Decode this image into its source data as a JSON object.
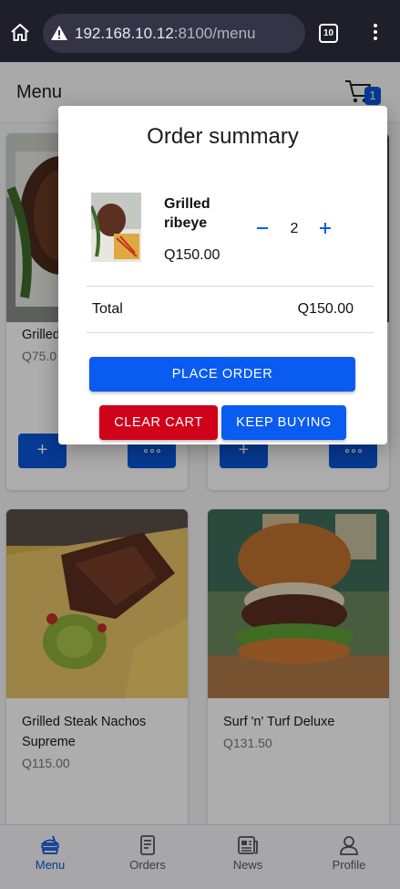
{
  "browser": {
    "url_host": "192.168.10.12",
    "url_path": ":8100/menu",
    "tab_count": "10",
    "icons": [
      "home-icon",
      "warning-icon",
      "tabs-icon",
      "kebab-menu-icon"
    ]
  },
  "header": {
    "title": "Menu",
    "cart_count": "1"
  },
  "menu": {
    "items": [
      {
        "name": "Grilled",
        "price": "Q75.0"
      },
      {
        "name": "",
        "price": ""
      },
      {
        "name": "Grilled Steak Nachos Supreme",
        "price": "Q115.00"
      },
      {
        "name": "Surf 'n' Turf Deluxe",
        "price": "Q131.50"
      }
    ],
    "add_label": "+"
  },
  "modal": {
    "title": "Order summary",
    "item": {
      "name": "Grilled ribeye",
      "price": "Q150.00",
      "quantity": "2"
    },
    "total_label": "Total",
    "total_value": "Q150.00",
    "place_order": "PLACE ORDER",
    "clear_cart": "CLEAR CART",
    "keep_buying": "KEEP BUYING"
  },
  "nav": {
    "items": [
      {
        "label": "Menu",
        "icon": "menu-food-icon",
        "active": true
      },
      {
        "label": "Orders",
        "icon": "orders-icon",
        "active": false
      },
      {
        "label": "News",
        "icon": "news-icon",
        "active": false
      },
      {
        "label": "Profile",
        "icon": "profile-icon",
        "active": false
      }
    ]
  },
  "colors": {
    "primary": "#0a56d9",
    "danger": "#d0021b",
    "browser_bar": "#1f1f2b"
  }
}
